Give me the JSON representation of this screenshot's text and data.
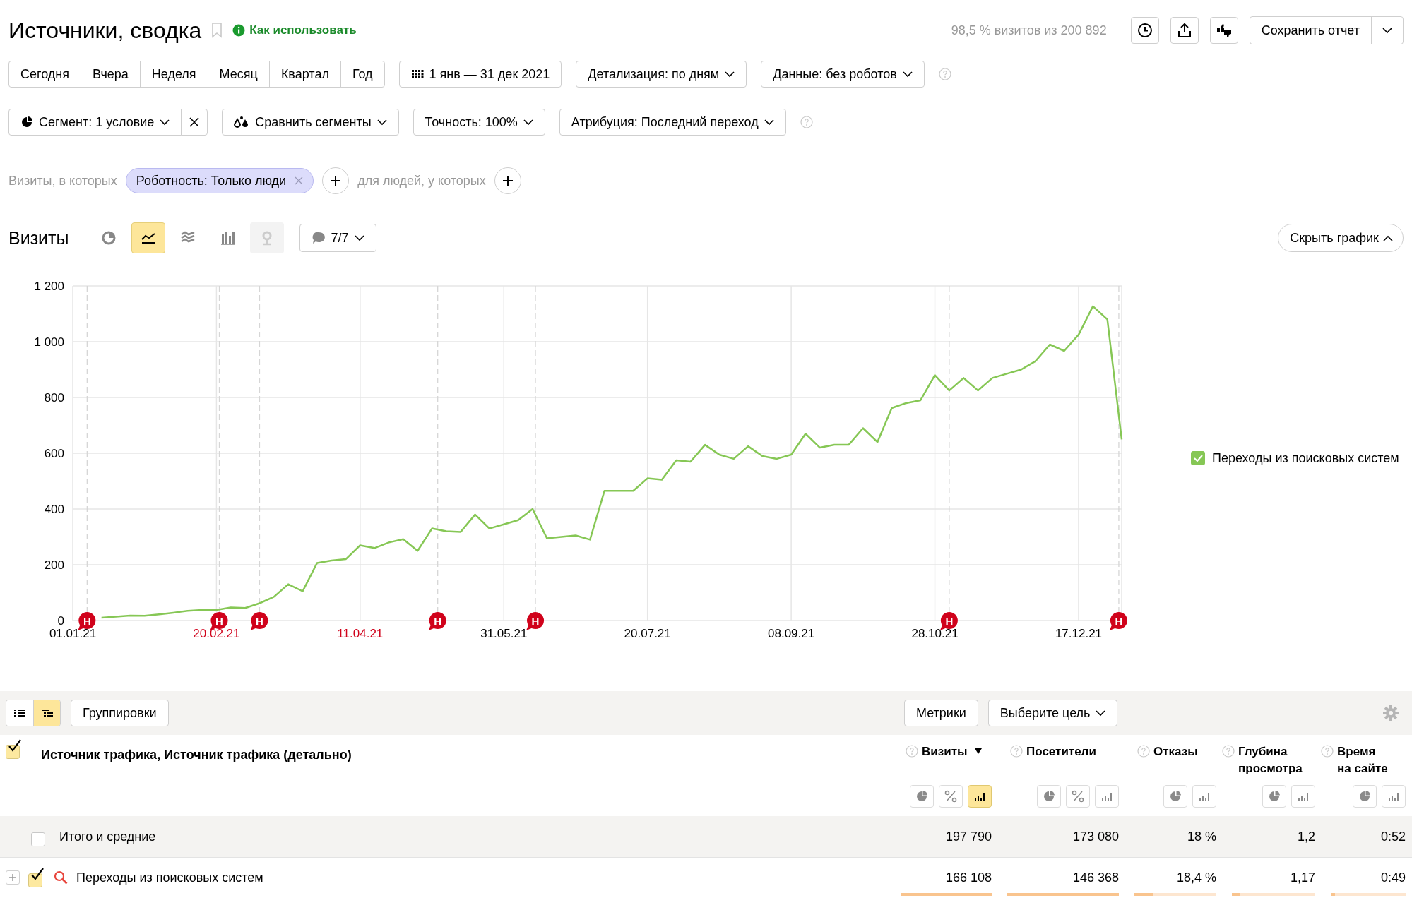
{
  "header": {
    "title": "Источники, сводка",
    "help_link": "Как использовать",
    "sampling": "98,5 % визитов из 200 892",
    "save_button": "Сохранить отчет"
  },
  "periods": [
    {
      "label": "Сегодня",
      "selected": false
    },
    {
      "label": "Вчера",
      "selected": false
    },
    {
      "label": "Неделя",
      "selected": false
    },
    {
      "label": "Месяц",
      "selected": false
    },
    {
      "label": "Квартал",
      "selected": false
    },
    {
      "label": "Год",
      "selected": false
    }
  ],
  "date_range": "1 янв — 31 дек 2021",
  "detail_dropdown": "Детализация: по дням",
  "data_dropdown": "Данные: без роботов",
  "segment_dropdown": "Сегмент: 1 условие",
  "compare_dropdown": "Сравнить сегменты",
  "accuracy_dropdown": "Точность: 100%",
  "attribution_dropdown": "Атрибуция: Последний переход",
  "filter": {
    "visits_label": "Визиты, в которых",
    "chip": "Роботность: Только люди",
    "people_label": "для людей, у которых"
  },
  "chart_panel": {
    "title": "Визиты",
    "chart_types": [
      {
        "kind": "pie",
        "selected": false,
        "disabled": false
      },
      {
        "kind": "line",
        "selected": true,
        "disabled": false
      },
      {
        "kind": "area",
        "selected": false,
        "disabled": false
      },
      {
        "kind": "bars",
        "selected": false,
        "disabled": false
      },
      {
        "kind": "map",
        "selected": false,
        "disabled": true
      }
    ],
    "annotations_button": "7/7",
    "hide_button": "Скрыть график",
    "legend": [
      {
        "checked": true
      }
    ],
    "holiday_ticks": [
      false,
      true,
      true,
      false,
      false,
      false,
      false,
      false
    ],
    "chart_data": {
      "type": "line",
      "grid": true,
      "ylim": [
        0,
        1200
      ],
      "categories": [
        "01.01.21",
        null,
        null,
        null,
        null,
        null,
        null,
        null,
        null,
        null,
        "20.02.21",
        null,
        null,
        null,
        null,
        null,
        null,
        null,
        null,
        null,
        "11.04.21",
        null,
        null,
        null,
        null,
        null,
        null,
        null,
        null,
        null,
        "31.05.21",
        null,
        null,
        null,
        null,
        null,
        null,
        null,
        null,
        null,
        "20.07.21",
        null,
        null,
        null,
        null,
        null,
        null,
        null,
        null,
        null,
        "08.09.21",
        null,
        null,
        null,
        null,
        null,
        null,
        null,
        null,
        null,
        "28.10.21",
        null,
        null,
        null,
        null,
        null,
        null,
        null,
        null,
        null,
        "17.12.21",
        null,
        null,
        null
      ],
      "series": [
        {
          "name": "Переходы из поисковых систем",
          "color": "#86c755",
          "values": [
            null,
            null,
            10,
            14,
            18,
            17,
            22,
            28,
            35,
            38,
            38,
            47,
            45,
            62,
            85,
            130,
            105,
            206,
            215,
            220,
            270,
            260,
            280,
            292,
            250,
            330,
            320,
            318,
            380,
            330,
            345,
            360,
            400,
            295,
            300,
            305,
            290,
            465,
            465,
            465,
            510,
            505,
            575,
            570,
            630,
            595,
            580,
            625,
            590,
            580,
            595,
            670,
            620,
            630,
            630,
            690,
            640,
            762,
            780,
            790,
            880,
            825,
            870,
            825,
            870,
            885,
            900,
            930,
            990,
            967,
            1025,
            1127,
            1080,
            650
          ]
        }
      ],
      "yticks": [
        0,
        200,
        400,
        600,
        800,
        {
          "value": 1000,
          "label": "1 000"
        },
        {
          "value": 1200,
          "label": "1 200"
        }
      ],
      "annotations": [
        {
          "text": "Н"
        },
        {
          "text": "Н"
        },
        {
          "text": "Н"
        },
        {
          "text": "Н"
        },
        {
          "text": "Н"
        },
        {
          "text": "Н"
        },
        {
          "text": "Н"
        }
      ]
    }
  },
  "table": {
    "view_modes": [
      {
        "kind": "list",
        "selected": false
      },
      {
        "kind": "tree",
        "selected": true
      }
    ],
    "groupings_button": "Группировки",
    "metrics_button": "Метрики",
    "goal_dropdown": "Выберите цель",
    "dimension_header": {
      "label": "Источник трафика, Источник трафика (детально)",
      "checked": true
    },
    "columns": [
      {
        "label": "Визиты",
        "sorted": true,
        "views": [
          {
            "kind": "pie",
            "selected": false
          },
          {
            "kind": "percent",
            "selected": false
          },
          {
            "kind": "bars",
            "selected": true
          }
        ]
      },
      {
        "label": "Посетители",
        "sorted": false,
        "views": [
          {
            "kind": "pie",
            "selected": false
          },
          {
            "kind": "percent",
            "selected": false
          },
          {
            "kind": "bars",
            "selected": false
          }
        ]
      },
      {
        "label": "Отказы",
        "sorted": false,
        "views": [
          {
            "kind": "pie",
            "selected": false
          },
          {
            "kind": "bars",
            "selected": false
          }
        ]
      },
      {
        "label": "Глубина просмотра",
        "sorted": false,
        "views": [
          {
            "kind": "pie",
            "selected": false
          },
          {
            "kind": "bars",
            "selected": false
          }
        ]
      },
      {
        "label": "Время на сайте",
        "sorted": false,
        "views": [
          {
            "kind": "pie",
            "selected": false
          },
          {
            "kind": "bars",
            "selected": false
          }
        ]
      }
    ],
    "rows": [
      {
        "kind": "total",
        "label": "Итого и средние",
        "checked": false,
        "cells": [
          {
            "value": "197 790"
          },
          {
            "value": "173 080"
          },
          {
            "value": "18 %"
          },
          {
            "value": "1,2"
          },
          {
            "value": "0:52"
          }
        ]
      },
      {
        "kind": "source",
        "label": "Переходы из поисковых систем",
        "checked": true,
        "expandable": true,
        "cells": [
          {
            "value": "166 108",
            "level": 1
          },
          {
            "value": "146 368",
            "level": 1
          },
          {
            "value": "18,4 %",
            "level": 0.22
          },
          {
            "value": "1,17",
            "level": 0.1
          },
          {
            "value": "0:49",
            "level": 0.06
          }
        ]
      }
    ]
  }
}
